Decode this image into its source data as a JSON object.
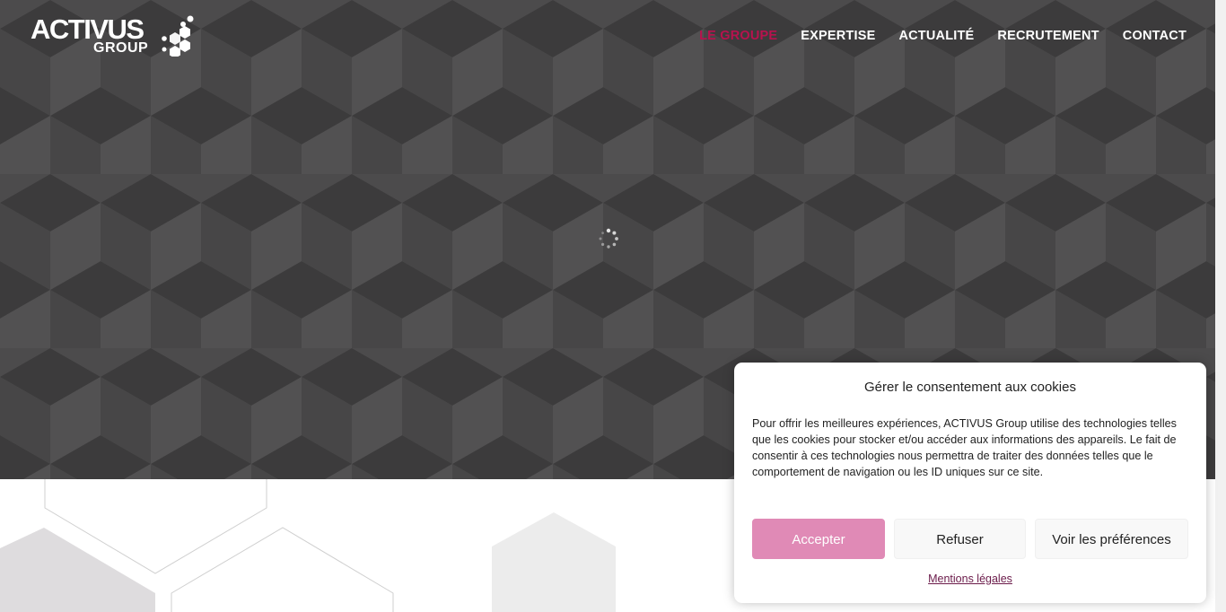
{
  "brand": {
    "logo_word": "ACTIVUS",
    "logo_sub": "GROUP",
    "accent_color": "#b8124e"
  },
  "nav": {
    "items": [
      {
        "label": "LE GROUPE",
        "active": true
      },
      {
        "label": "EXPERTISE",
        "active": false
      },
      {
        "label": "ACTUALITÉ",
        "active": false
      },
      {
        "label": "RECRUTEMENT",
        "active": false
      },
      {
        "label": "CONTACT",
        "active": false
      }
    ]
  },
  "hero": {
    "loading_icon": "spinner-icon"
  },
  "cookie": {
    "title": "Gérer le consentement aux cookies",
    "text": "Pour offrir les meilleures expériences, ACTIVUS Group utilise des technologies telles que les cookies pour stocker et/ou accéder aux informations des appareils. Le fait de consentir à ces technologies nous permettra de traiter des données telles que le comportement de navigation ou les ID uniques sur ce site.",
    "accept_label": "Accepter",
    "refuse_label": "Refuser",
    "prefs_label": "Voir les préférences",
    "legal_link": "Mentions légales",
    "accept_color": "#e08ab6"
  }
}
